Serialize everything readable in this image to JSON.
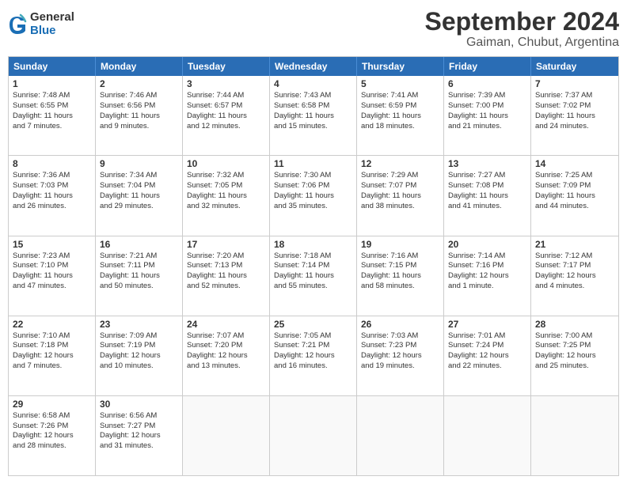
{
  "header": {
    "logo_general": "General",
    "logo_blue": "Blue",
    "title": "September 2024",
    "subtitle": "Gaiman, Chubut, Argentina"
  },
  "day_names": [
    "Sunday",
    "Monday",
    "Tuesday",
    "Wednesday",
    "Thursday",
    "Friday",
    "Saturday"
  ],
  "weeks": [
    [
      {
        "day": 1,
        "lines": [
          "Sunrise: 7:48 AM",
          "Sunset: 6:55 PM",
          "Daylight: 11 hours",
          "and 7 minutes."
        ]
      },
      {
        "day": 2,
        "lines": [
          "Sunrise: 7:46 AM",
          "Sunset: 6:56 PM",
          "Daylight: 11 hours",
          "and 9 minutes."
        ]
      },
      {
        "day": 3,
        "lines": [
          "Sunrise: 7:44 AM",
          "Sunset: 6:57 PM",
          "Daylight: 11 hours",
          "and 12 minutes."
        ]
      },
      {
        "day": 4,
        "lines": [
          "Sunrise: 7:43 AM",
          "Sunset: 6:58 PM",
          "Daylight: 11 hours",
          "and 15 minutes."
        ]
      },
      {
        "day": 5,
        "lines": [
          "Sunrise: 7:41 AM",
          "Sunset: 6:59 PM",
          "Daylight: 11 hours",
          "and 18 minutes."
        ]
      },
      {
        "day": 6,
        "lines": [
          "Sunrise: 7:39 AM",
          "Sunset: 7:00 PM",
          "Daylight: 11 hours",
          "and 21 minutes."
        ]
      },
      {
        "day": 7,
        "lines": [
          "Sunrise: 7:37 AM",
          "Sunset: 7:02 PM",
          "Daylight: 11 hours",
          "and 24 minutes."
        ]
      }
    ],
    [
      {
        "day": 8,
        "lines": [
          "Sunrise: 7:36 AM",
          "Sunset: 7:03 PM",
          "Daylight: 11 hours",
          "and 26 minutes."
        ]
      },
      {
        "day": 9,
        "lines": [
          "Sunrise: 7:34 AM",
          "Sunset: 7:04 PM",
          "Daylight: 11 hours",
          "and 29 minutes."
        ]
      },
      {
        "day": 10,
        "lines": [
          "Sunrise: 7:32 AM",
          "Sunset: 7:05 PM",
          "Daylight: 11 hours",
          "and 32 minutes."
        ]
      },
      {
        "day": 11,
        "lines": [
          "Sunrise: 7:30 AM",
          "Sunset: 7:06 PM",
          "Daylight: 11 hours",
          "and 35 minutes."
        ]
      },
      {
        "day": 12,
        "lines": [
          "Sunrise: 7:29 AM",
          "Sunset: 7:07 PM",
          "Daylight: 11 hours",
          "and 38 minutes."
        ]
      },
      {
        "day": 13,
        "lines": [
          "Sunrise: 7:27 AM",
          "Sunset: 7:08 PM",
          "Daylight: 11 hours",
          "and 41 minutes."
        ]
      },
      {
        "day": 14,
        "lines": [
          "Sunrise: 7:25 AM",
          "Sunset: 7:09 PM",
          "Daylight: 11 hours",
          "and 44 minutes."
        ]
      }
    ],
    [
      {
        "day": 15,
        "lines": [
          "Sunrise: 7:23 AM",
          "Sunset: 7:10 PM",
          "Daylight: 11 hours",
          "and 47 minutes."
        ]
      },
      {
        "day": 16,
        "lines": [
          "Sunrise: 7:21 AM",
          "Sunset: 7:11 PM",
          "Daylight: 11 hours",
          "and 50 minutes."
        ]
      },
      {
        "day": 17,
        "lines": [
          "Sunrise: 7:20 AM",
          "Sunset: 7:13 PM",
          "Daylight: 11 hours",
          "and 52 minutes."
        ]
      },
      {
        "day": 18,
        "lines": [
          "Sunrise: 7:18 AM",
          "Sunset: 7:14 PM",
          "Daylight: 11 hours",
          "and 55 minutes."
        ]
      },
      {
        "day": 19,
        "lines": [
          "Sunrise: 7:16 AM",
          "Sunset: 7:15 PM",
          "Daylight: 11 hours",
          "and 58 minutes."
        ]
      },
      {
        "day": 20,
        "lines": [
          "Sunrise: 7:14 AM",
          "Sunset: 7:16 PM",
          "Daylight: 12 hours",
          "and 1 minute."
        ]
      },
      {
        "day": 21,
        "lines": [
          "Sunrise: 7:12 AM",
          "Sunset: 7:17 PM",
          "Daylight: 12 hours",
          "and 4 minutes."
        ]
      }
    ],
    [
      {
        "day": 22,
        "lines": [
          "Sunrise: 7:10 AM",
          "Sunset: 7:18 PM",
          "Daylight: 12 hours",
          "and 7 minutes."
        ]
      },
      {
        "day": 23,
        "lines": [
          "Sunrise: 7:09 AM",
          "Sunset: 7:19 PM",
          "Daylight: 12 hours",
          "and 10 minutes."
        ]
      },
      {
        "day": 24,
        "lines": [
          "Sunrise: 7:07 AM",
          "Sunset: 7:20 PM",
          "Daylight: 12 hours",
          "and 13 minutes."
        ]
      },
      {
        "day": 25,
        "lines": [
          "Sunrise: 7:05 AM",
          "Sunset: 7:21 PM",
          "Daylight: 12 hours",
          "and 16 minutes."
        ]
      },
      {
        "day": 26,
        "lines": [
          "Sunrise: 7:03 AM",
          "Sunset: 7:23 PM",
          "Daylight: 12 hours",
          "and 19 minutes."
        ]
      },
      {
        "day": 27,
        "lines": [
          "Sunrise: 7:01 AM",
          "Sunset: 7:24 PM",
          "Daylight: 12 hours",
          "and 22 minutes."
        ]
      },
      {
        "day": 28,
        "lines": [
          "Sunrise: 7:00 AM",
          "Sunset: 7:25 PM",
          "Daylight: 12 hours",
          "and 25 minutes."
        ]
      }
    ],
    [
      {
        "day": 29,
        "lines": [
          "Sunrise: 6:58 AM",
          "Sunset: 7:26 PM",
          "Daylight: 12 hours",
          "and 28 minutes."
        ]
      },
      {
        "day": 30,
        "lines": [
          "Sunrise: 6:56 AM",
          "Sunset: 7:27 PM",
          "Daylight: 12 hours",
          "and 31 minutes."
        ]
      },
      {
        "day": null,
        "lines": []
      },
      {
        "day": null,
        "lines": []
      },
      {
        "day": null,
        "lines": []
      },
      {
        "day": null,
        "lines": []
      },
      {
        "day": null,
        "lines": []
      }
    ]
  ]
}
